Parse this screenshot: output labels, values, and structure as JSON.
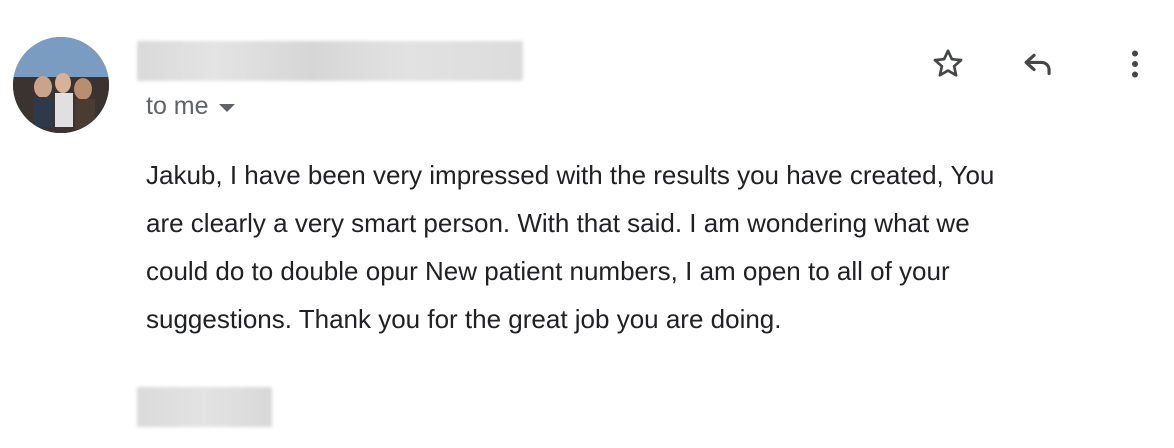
{
  "message": {
    "recipient_label": "to me",
    "body": "Jakub, I have been very impressed with the results you have created, You\nare clearly a very smart person. With that said. I am wondering what we\ncould do to double opur New patient numbers, I am open to all of your\nsuggestions. Thank you for the great job you are doing."
  },
  "actions": {
    "star_icon": "star-icon",
    "reply_icon": "reply-icon",
    "more_icon": "more-vertical-icon"
  },
  "colors": {
    "text": "#202124",
    "secondary_text": "#5f6368",
    "icon": "#444746",
    "redaction": "#dcdcdc"
  }
}
